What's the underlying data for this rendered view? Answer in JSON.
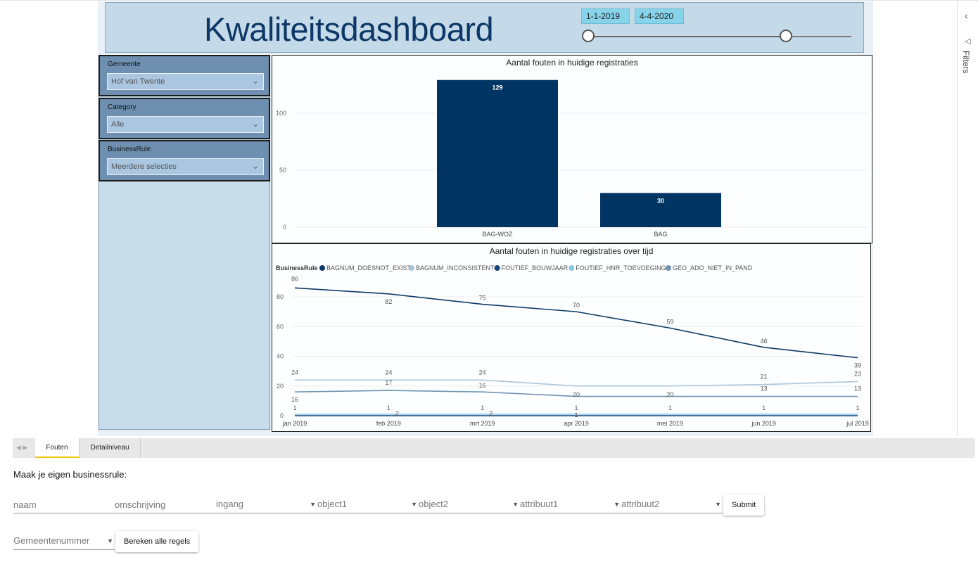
{
  "report": {
    "title": "Kwaliteitsdashboard",
    "date_start": "1-1-2019",
    "date_end": "4-4-2020",
    "range_start_fraction": 0.0,
    "range_end_fraction": 0.75
  },
  "slicers": [
    {
      "label": "Gemeente",
      "value": "Hof van Twente"
    },
    {
      "label": "Category",
      "value": "Alle"
    },
    {
      "label": "BusinessRule",
      "value": "Meerdere selecties"
    }
  ],
  "filters_pane": {
    "label": "Filters"
  },
  "tabs": [
    {
      "label": "Fouten",
      "active": true
    },
    {
      "label": "Detailniveau",
      "active": false
    }
  ],
  "form": {
    "title": "Maak je eigen businessrule:",
    "naam": "naam",
    "omschrijving": "omschrijving",
    "ingang": "ingang",
    "object1": "object1",
    "object2": "object2",
    "attribuut1": "attribuut1",
    "attribuut2": "attribuut2",
    "submit": "Submit",
    "gemeentenummer": "Gemeentenummer",
    "bereken": "Bereken alle regels"
  },
  "colors": {
    "bar": "#003462",
    "header_bg": "#c5dae8",
    "slicer_bg": "#6e8fb0",
    "accent_tab": "#f2c811"
  },
  "chart_data": [
    {
      "type": "bar",
      "title": "Aantal fouten in huidige registraties",
      "categories": [
        "BAG-WOZ",
        "BAG"
      ],
      "values": [
        129,
        30
      ],
      "y_ticks": [
        0,
        50,
        100
      ],
      "ylim": [
        0,
        135
      ],
      "grid": true
    },
    {
      "type": "line",
      "title": "Aantal fouten in huidige registraties over tijd",
      "legend_title": "BusinessRule",
      "legend_position": "top-left",
      "x": [
        "jan 2019",
        "feb 2019",
        "mrt 2019",
        "apr 2019",
        "mei 2019",
        "jun 2019",
        "jul 2019"
      ],
      "y_ticks": [
        0,
        20,
        40,
        60,
        80
      ],
      "ylim": [
        0,
        89
      ],
      "series": [
        {
          "name": "BAGNUM_DOESNOT_EXIST",
          "color": "#0d3a66",
          "values": [
            86,
            82,
            75,
            70,
            59,
            46,
            39
          ],
          "show_labels": [
            true,
            true,
            true,
            true,
            true,
            true,
            true
          ]
        },
        {
          "name": "BAGNUM_INCONSISTENT",
          "color": "#a9c6dc",
          "values": [
            24,
            24,
            24,
            20,
            20,
            21,
            23
          ],
          "show_labels": [
            true,
            true,
            true,
            false,
            false,
            true,
            true
          ]
        },
        {
          "name": "FOUTIEF_BOUWJAAR",
          "color": "#14427a",
          "values": [
            0,
            0,
            0,
            0,
            0,
            0,
            0
          ],
          "show_labels": [
            false,
            false,
            false,
            false,
            false,
            false,
            false
          ]
        },
        {
          "name": "FOUTIEF_HNR_TOEVOEGING",
          "color": "#8cc8e6",
          "values": [
            1,
            1,
            1,
            1,
            1,
            1,
            1
          ],
          "show_labels": [
            true,
            true,
            true,
            true,
            true,
            true,
            true
          ]
        },
        {
          "name": "GEO_ADO_NIET_IN_PAND",
          "color": "#6f93b2",
          "values": [
            16,
            17,
            16,
            13,
            13,
            13,
            13
          ],
          "show_labels": [
            true,
            true,
            true,
            false,
            false,
            true,
            true
          ]
        }
      ],
      "extra_labels": [
        {
          "x": "feb 2019",
          "text": "2"
        },
        {
          "x": "mrt 2019",
          "text": "2"
        },
        {
          "x": "apr 2019",
          "text": "20"
        },
        {
          "x": "mei 2019",
          "text": "20"
        },
        {
          "x": "apr 2019",
          "text": "1"
        }
      ],
      "grid": true
    }
  ]
}
